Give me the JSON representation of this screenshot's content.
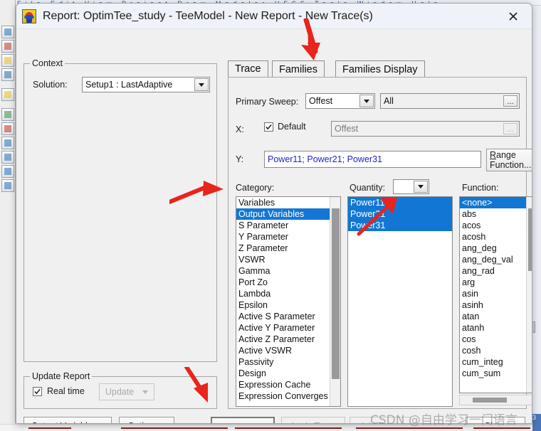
{
  "window": {
    "title": "Report: OptimTee_study - TeeModel - New Report - New Trace(s)",
    "app_icon": "hfss-report-icon",
    "close_label": "close-icon"
  },
  "background": {
    "menu_hint": "File  Edit  View  Project  Draw  Modeler  HFSS  Tools  Window  Help",
    "vs_badge": "3"
  },
  "context": {
    "group_title": "Context",
    "solution_label": "Solution:",
    "solution_value": "Setup1 : LastAdaptive"
  },
  "update_report": {
    "group_title": "Update Report",
    "realtime_label": "Real time",
    "realtime_checked": true,
    "update_label": "Update",
    "update_enabled": false
  },
  "tabs": [
    {
      "label": "Trace",
      "active": true
    },
    {
      "label": "Families",
      "active": false
    },
    {
      "label": "Families Display",
      "active": false
    }
  ],
  "trace": {
    "primary_sweep_label": "Primary Sweep:",
    "primary_sweep_value": "Offest",
    "sweep_range_value": "All",
    "sweep_range_ellipsis": "...",
    "x_label": "X:",
    "x_default_label": "Default",
    "x_default_checked": true,
    "x_value": "Offest",
    "x_ellipsis": "...",
    "y_label": "Y:",
    "y_value": "Power11; Power21; Power31",
    "y_value_color": "#2222cc",
    "range_function_label_line1": "Range",
    "range_function_label_line2": "Function..."
  },
  "category": {
    "label": "Category:",
    "items": [
      "Variables",
      "Output Variables",
      "S Parameter",
      "Y Parameter",
      "Z Parameter",
      "VSWR",
      "Gamma",
      "Port Zo",
      "Lambda",
      "Epsilon",
      "Active S Parameter",
      "Active Y Parameter",
      "Active Z Parameter",
      "Active VSWR",
      "Passivity",
      "Design",
      "Expression Cache",
      "Expression Converges"
    ],
    "selected": [
      "Output Variables"
    ]
  },
  "quantity": {
    "label": "Quantity:",
    "filter_value": "",
    "items": [
      "Power11",
      "Power21",
      "Power31"
    ],
    "selected": [
      "Power11",
      "Power21",
      "Power31"
    ]
  },
  "function": {
    "label": "Function:",
    "items": [
      "<none>",
      "abs",
      "acos",
      "acosh",
      "ang_deg",
      "ang_deg_val",
      "ang_rad",
      "arg",
      "asin",
      "asinh",
      "atan",
      "atanh",
      "cos",
      "cosh",
      "cum_integ",
      "cum_sum"
    ],
    "selected": [
      "<none>"
    ]
  },
  "footer": {
    "output_variables_label": "Output Variables...",
    "options_label": "Options...",
    "new_report_label": "New Report",
    "apply_trace_label": "Apply Trace",
    "apply_trace_enabled": false,
    "add_trace_label": "Add Trace",
    "add_trace_enabled": false,
    "close_label": "Close"
  },
  "annotations": {
    "arrow_color": "#e8241c",
    "arrows": [
      "points-to-families-display-tab",
      "points-to-output-variables-category",
      "points-to-power-quantity-list",
      "points-to-new-report-button"
    ]
  },
  "watermark": {
    "text": "CSDN @自由学习一门语言"
  }
}
